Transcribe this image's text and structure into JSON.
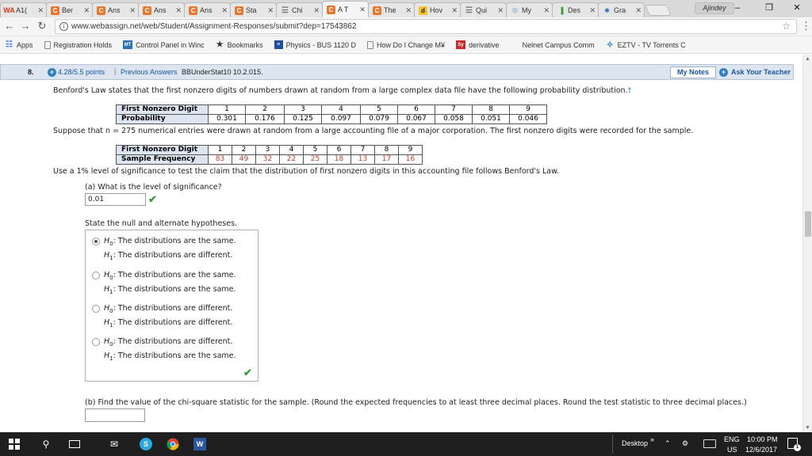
{
  "browser": {
    "tabs": [
      {
        "label": "A1(",
        "icon": "wolfram-alpha-icon",
        "glyph": "WA",
        "cls": "wa"
      },
      {
        "label": "Ber",
        "icon": "c-icon",
        "glyph": "C",
        "cls": "c"
      },
      {
        "label": "Ans",
        "icon": "c-icon",
        "glyph": "C",
        "cls": "c"
      },
      {
        "label": "Ans",
        "icon": "c-icon",
        "glyph": "C",
        "cls": "c"
      },
      {
        "label": "Ans",
        "icon": "c-icon",
        "glyph": "C",
        "cls": "c"
      },
      {
        "label": "Sta",
        "icon": "c-icon",
        "glyph": "C",
        "cls": "c"
      },
      {
        "label": "Chi",
        "icon": "list-icon",
        "glyph": "☰",
        "cls": "grid"
      },
      {
        "label": "A T",
        "icon": "c-icon",
        "glyph": "C",
        "cls": "c",
        "active": true
      },
      {
        "label": "The",
        "icon": "c-icon",
        "glyph": "C",
        "cls": "c"
      },
      {
        "label": "Hov",
        "icon": "d-icon",
        "glyph": "d",
        "cls": "d"
      },
      {
        "label": "Qui",
        "icon": "list-icon",
        "glyph": "☰",
        "cls": "grid"
      },
      {
        "label": "My",
        "icon": "lightbulb-icon",
        "glyph": "☉",
        "cls": "bulb"
      },
      {
        "label": "Des",
        "icon": "bar-chart-icon",
        "glyph": "▐",
        "cls": "bars"
      },
      {
        "label": "Gra",
        "icon": "graph-icon",
        "glyph": "✵",
        "cls": "gr"
      }
    ],
    "user_badge": "Ajindey",
    "url": "www.webassign.net/web/Student/Assignment-Responses/submit?dep=17543862",
    "bookmarks": [
      {
        "label": "Apps",
        "icon": "apps-grid-icon",
        "glyph": "☷",
        "cls": "apps"
      },
      {
        "label": "Registration Holds",
        "icon": "page-icon",
        "glyph": "",
        "cls": "page"
      },
      {
        "label": "Control Panel in Winc",
        "icon": "mt-icon",
        "glyph": "MT",
        "cls": "mt"
      },
      {
        "label": "Bookmarks",
        "icon": "star-icon",
        "glyph": "★",
        "cls": "bstar"
      },
      {
        "label": "Physics - BUS 1120 D",
        "icon": "doc-icon",
        "glyph": "≡",
        "cls": "doc"
      },
      {
        "label": "How Do I Change M¥",
        "icon": "page-icon",
        "glyph": "",
        "cls": "page"
      },
      {
        "label": "derivative",
        "icon": "symbolab-icon",
        "glyph": "Sy",
        "cls": "sy"
      },
      {
        "label": "Nelnet Campus Comm",
        "icon": "blank-icon",
        "glyph": "",
        "cls": ""
      },
      {
        "label": "EZTV - TV Torrents C",
        "icon": "eztv-icon",
        "glyph": "✧",
        "cls": "ez"
      }
    ]
  },
  "question": {
    "number": "8.",
    "points": "4.28/5.5 points",
    "separator": "|",
    "previous_answers": "Previous Answers",
    "id": "BBUnderStat10 10.2.015.",
    "my_notes": "My Notes",
    "ask_teacher": "Ask Your Teacher",
    "intro": "Benford's Law states that the first nonzero digits of numbers drawn at random from a large complex data file have the following probability distribution.",
    "dagger": "†",
    "table1": {
      "row1_header": "First Nonzero Digit",
      "digits": [
        "1",
        "2",
        "3",
        "4",
        "5",
        "6",
        "7",
        "8",
        "9"
      ],
      "row2_header": "Probability",
      "probabilities": [
        "0.301",
        "0.176",
        "0.125",
        "0.097",
        "0.079",
        "0.067",
        "0.058",
        "0.051",
        "0.046"
      ]
    },
    "sample_text": "Suppose that n = 275 numerical entries were drawn at random from a large accounting file of a major corporation. The first nonzero digits were recorded for the sample.",
    "table2": {
      "row1_header": "First Nonzero Digit",
      "digits": [
        "1",
        "2",
        "3",
        "4",
        "5",
        "6",
        "7",
        "8",
        "9"
      ],
      "row2_header": "Sample Frequency",
      "frequencies": [
        "83",
        "49",
        "32",
        "22",
        "25",
        "18",
        "13",
        "17",
        "16"
      ]
    },
    "claim_text": "Use a 1% level of significance to test the claim that the distribution of first nonzero digits in this accounting file follows Benford's Law.",
    "part_a": "(a) What is the level of significance?",
    "part_a_answer": "0.01",
    "hypotheses_prompt": "State the null and alternate hypotheses.",
    "options": [
      {
        "h0": "The distributions are the same.",
        "h1": "The distributions are different.",
        "selected": true
      },
      {
        "h0": "The distributions are the same.",
        "h1": "The distributions are the same.",
        "selected": false
      },
      {
        "h0": "The distributions are different.",
        "h1": "The distributions are different.",
        "selected": false
      },
      {
        "h0": "The distributions are different.",
        "h1": "The distributions are the same.",
        "selected": false
      }
    ],
    "part_b": "(b) Find the value of the chi-square statistic for the sample. (Round the expected frequencies to at least three decimal places. Round the test statistic to three decimal places.)",
    "part_b_answer": ""
  },
  "taskbar": {
    "desktop": "Desktop",
    "chevron": "»",
    "lang1": "ENG",
    "lang2": "US",
    "time": "10:00 PM",
    "date": "12/6/2017",
    "notif_count": "1"
  }
}
